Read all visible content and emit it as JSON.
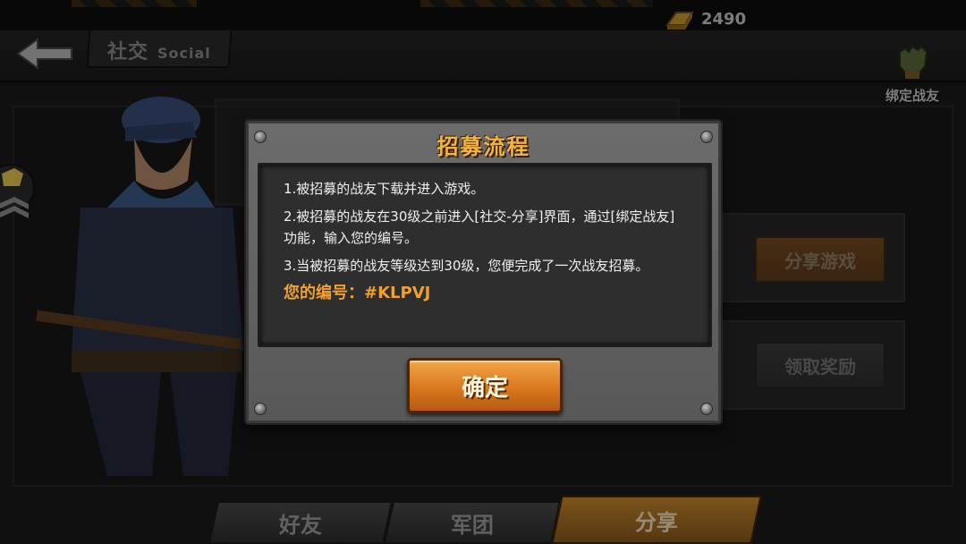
{
  "header": {
    "title": "社交",
    "title_sub": "Social",
    "gold_amount": "2490",
    "bind_friend_label": "绑定战友"
  },
  "side_buttons": {
    "share_game": "分享游戏",
    "claim_reward": "领取奖励"
  },
  "tabs": [
    {
      "label": "好友",
      "active": false
    },
    {
      "label": "军团",
      "active": false
    },
    {
      "label": "分享",
      "active": true
    }
  ],
  "dialog": {
    "title": "招募流程",
    "steps": [
      "1.被招募的战友下载并进入游戏。",
      "2.被招募的战友在30级之前进入[社交-分享]界面，通过[绑定战友]功能，输入您的编号。",
      "3.当被招募的战友等级达到30级，您便完成了一次战友招募。"
    ],
    "recruit_id": "您的编号：#KLPVJ",
    "confirm_label": "确定"
  },
  "colors": {
    "dialog_title": "#f2b443",
    "recruit_id": "#f0a030",
    "confirm_button": "#d9781f",
    "active_tab": "#c8872e"
  },
  "icons": [
    "back-arrow-icon",
    "gold-bar-icon",
    "glove-icon",
    "rank-badge-icon"
  ]
}
